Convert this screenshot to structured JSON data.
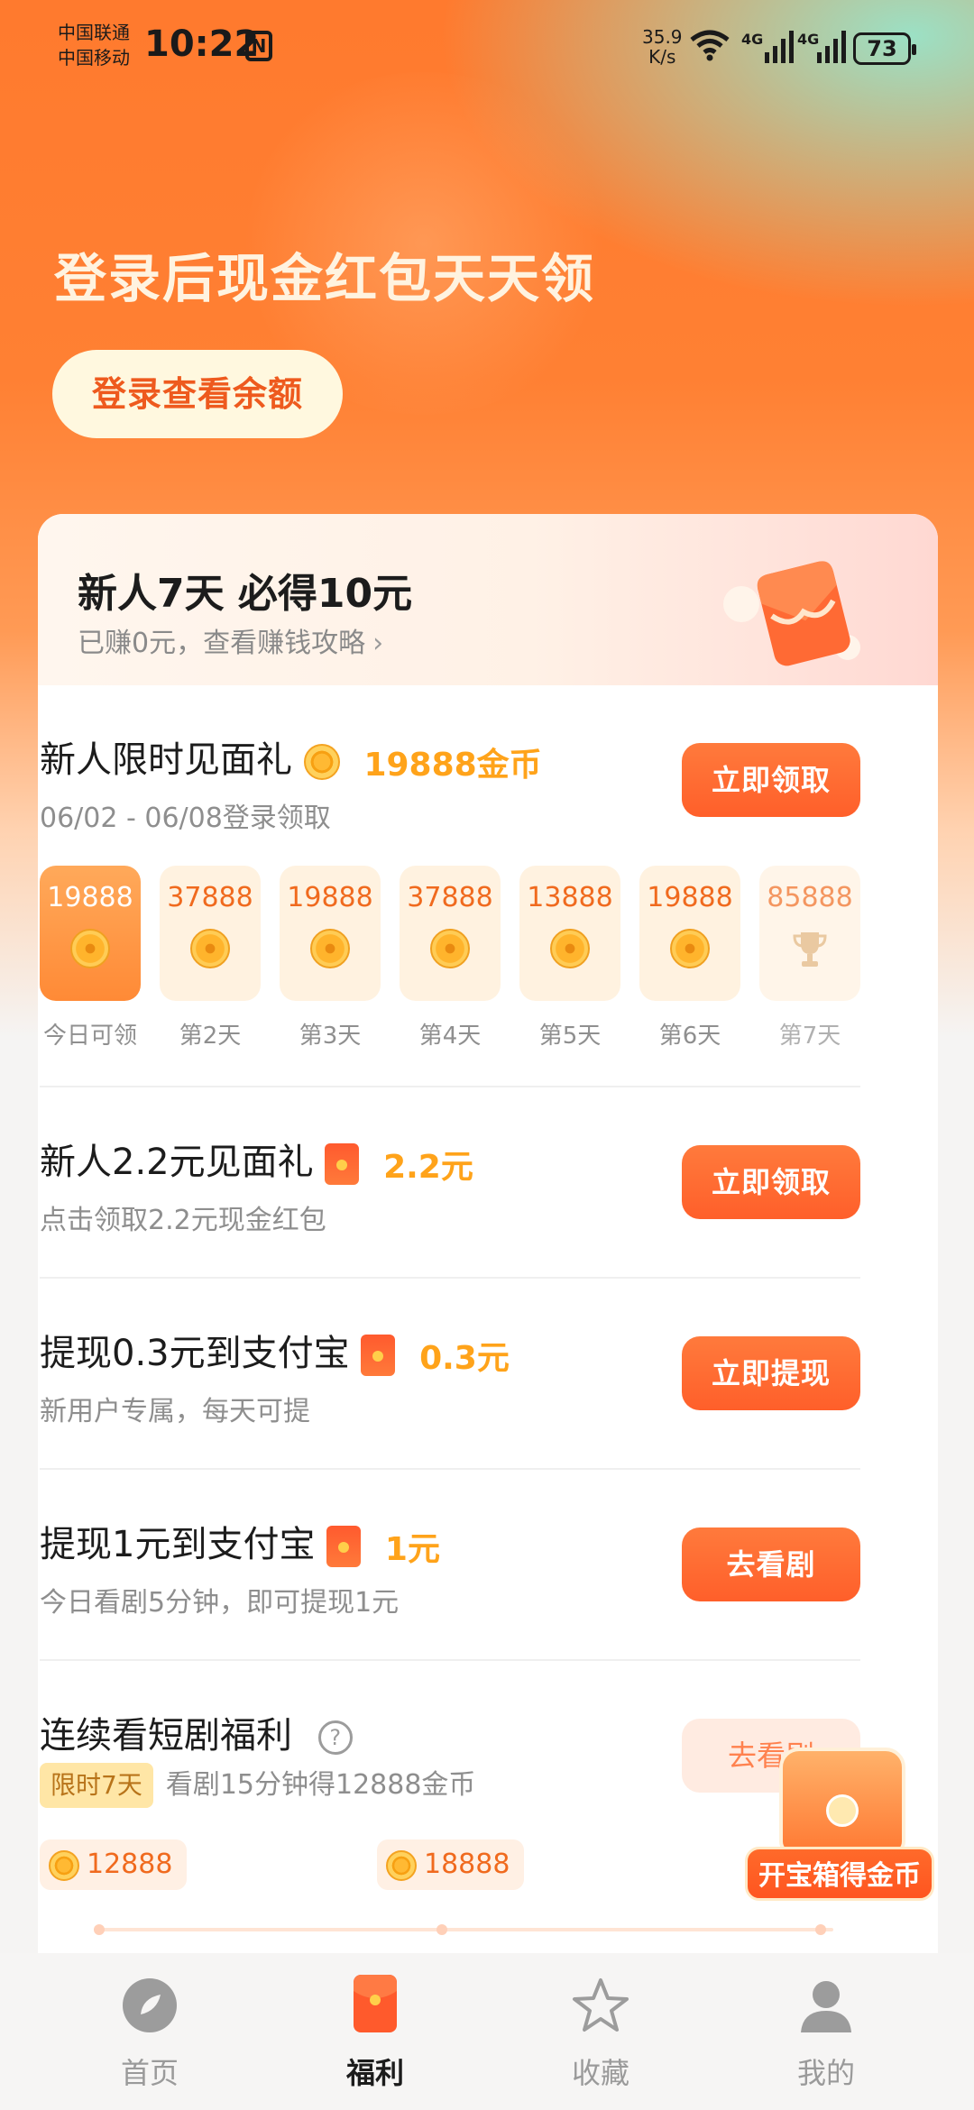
{
  "status_bar": {
    "carrier1": "中国联通",
    "carrier2": "中国移动",
    "time": "10:22",
    "nfc": "N",
    "speed_value": "35.9",
    "speed_unit": "K/s",
    "net1": "4G",
    "net2": "4G",
    "battery": "73"
  },
  "hero": {
    "title": "登录后现金红包天天领",
    "login_button": "登录查看余额"
  },
  "card_header": {
    "title": "新人7天 必得10元",
    "subtitle": "已赚0元，查看赚钱攻略",
    "chevron": "›"
  },
  "tasks": [
    {
      "title": "新人限时见面礼",
      "reward": "19888金币",
      "subtitle": "06/02 - 06/08登录领取",
      "button": "立即领取"
    },
    {
      "title": "新人2.2元见面礼",
      "reward": "2.2元",
      "subtitle": "点击领取2.2元现金红包",
      "button": "立即领取"
    },
    {
      "title": "提现0.3元到支付宝",
      "reward": "0.3元",
      "subtitle": "新用户专属，每天可提",
      "button": "立即提现"
    },
    {
      "title": "提现1元到支付宝",
      "reward": "1元",
      "subtitle": "今日看剧5分钟，即可提现1元",
      "button": "去看剧"
    },
    {
      "title": "连续看短剧福利",
      "help": "?",
      "tag": "限时7天",
      "subtitle": "看剧15分钟得12888金币",
      "button": "去看剧"
    }
  ],
  "days": [
    {
      "amount": "19888",
      "label": "今日可领",
      "active": true
    },
    {
      "amount": "37888",
      "label": "第2天"
    },
    {
      "amount": "19888",
      "label": "第3天"
    },
    {
      "amount": "37888",
      "label": "第4天"
    },
    {
      "amount": "13888",
      "label": "第5天"
    },
    {
      "amount": "19888",
      "label": "第6天"
    },
    {
      "amount": "85888",
      "label": "第7天",
      "icon": "trophy-icon"
    }
  ],
  "milestones": [
    "12888",
    "18888"
  ],
  "treasure": {
    "label": "开宝箱得金币"
  },
  "bottom_nav": [
    {
      "label": "首页",
      "icon": "compass-icon"
    },
    {
      "label": "福利",
      "icon": "red-envelope-icon",
      "active": true
    },
    {
      "label": "收藏",
      "icon": "star-icon"
    },
    {
      "label": "我的",
      "icon": "person-icon"
    }
  ],
  "colors": {
    "accent": "#ff6a2c",
    "reward": "#ffa31a",
    "hero_top": "#ff7a2e",
    "hero_mint": "#96e6cd"
  }
}
